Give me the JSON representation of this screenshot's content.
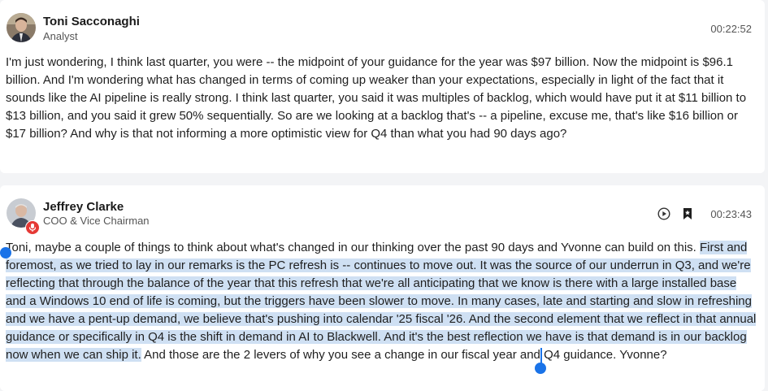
{
  "entries": [
    {
      "speaker": "Toni Sacconaghi",
      "role": "Analyst",
      "time": "00:22:52",
      "text": "I'm just wondering, I think last quarter, you were -- the midpoint of your guidance for the year was $97 billion. Now the midpoint is $96.1 billion. And I'm wondering what has changed in terms of coming up weaker than your expectations, especially in light of the fact that it sounds like the AI pipeline is really strong. I think last quarter, you said it was multiples of backlog, which would have put it at $11 billion to $13 billion, and you said it grew 50% sequentially. So are we looking at a backlog that's -- a pipeline, excuse me, that's like $16 billion or $17 billion? And why is that not informing a more optimistic view for Q4 than what you had 90 days ago?"
    },
    {
      "speaker": "Jeffrey Clarke",
      "role": "COO & Vice Chairman",
      "time": "00:23:43",
      "text_first": "Toni, maybe a couple of things to think about what's changed in our thinking over the past 90 days and Yvonne can build on this.",
      "text_highlight": "First and foremost, as we tried to lay in our remarks is the PC refresh is -- continues to move out. It was the source of our underrun in Q3, and we're reflecting that through the balance of the year that this refresh that we're all anticipating that we know is there with a large installed base and a Windows 10 end of life is coming, but the triggers have been slower to move. In many cases, late and starting and slow in refreshing and we have a pent-up demand, we believe that's pushing into calendar '25 fiscal '26. And the second element that we reflect in that annual guidance or specifically in Q4 is the shift in demand in AI to Blackwell. And it's the best reflection we have is that demand is in our backlog now when we can ship it.",
      "text_rest": " And those are the 2 levers of why you see a change in our fiscal year and Q4 guidance. Yvonne?"
    }
  ],
  "icons": {
    "play": "play-circle-icon",
    "bookmark": "bookmark-icon",
    "mic": "microphone-icon"
  },
  "colors": {
    "highlight": "#cfe0f3",
    "selection_handle": "#1a73e8",
    "mic_badge": "#e53935"
  }
}
